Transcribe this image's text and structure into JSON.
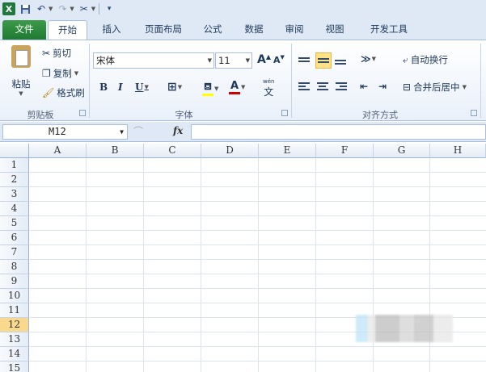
{
  "qat": {
    "app_icon": "excel-logo-icon",
    "items": [
      "save-icon",
      "undo-icon",
      "redo-icon",
      "customize-icon"
    ]
  },
  "tabs": [
    {
      "label": "文件",
      "active": false
    },
    {
      "label": "开始",
      "active": true
    },
    {
      "label": "插入",
      "active": false
    },
    {
      "label": "页面布局",
      "active": false
    },
    {
      "label": "公式",
      "active": false
    },
    {
      "label": "数据",
      "active": false
    },
    {
      "label": "审阅",
      "active": false
    },
    {
      "label": "视图",
      "active": false
    },
    {
      "label": "开发工具",
      "active": false
    }
  ],
  "clipboard": {
    "paste": "粘贴",
    "cut": "剪切",
    "copy": "复制",
    "format_painter": "格式刷",
    "group_label": "剪贴板"
  },
  "font": {
    "font_name": "宋体",
    "font_size": "11",
    "bold": "B",
    "italic": "I",
    "underline": "U",
    "font_color_glyph": "A",
    "grow_glyph": "A",
    "shrink_glyph": "A",
    "wen_glyph": "wén",
    "group_label": "字体"
  },
  "alignment": {
    "wrap_text": "自动换行",
    "merge_center": "合并后居中",
    "group_label": "对齐方式"
  },
  "formula_bar": {
    "name_box": "M12",
    "fx": "fx",
    "formula": ""
  },
  "grid": {
    "columns": [
      "A",
      "B",
      "C",
      "D",
      "E",
      "F",
      "G",
      "H"
    ],
    "rows": [
      "1",
      "2",
      "3",
      "4",
      "5",
      "6",
      "7",
      "8",
      "9",
      "10",
      "11",
      "12",
      "13",
      "14",
      "15"
    ],
    "active_row": "12"
  },
  "colors": {
    "file_tab": "#1f7a32",
    "ribbon_bg": "#dfe9f5",
    "active_row_header": "#f9d98d",
    "font_color_bar": "#d00000",
    "highlight_bar": "#ffff00"
  }
}
